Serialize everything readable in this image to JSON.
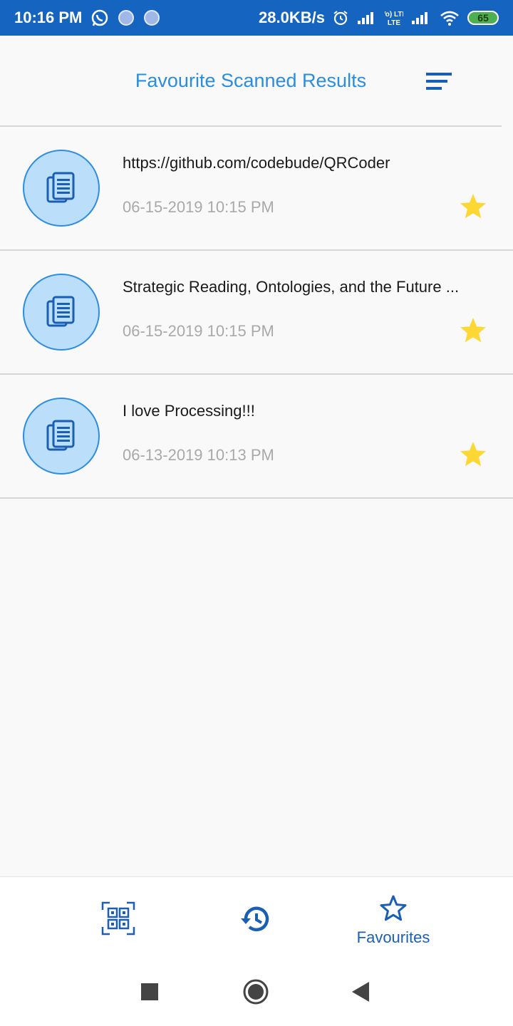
{
  "status_bar": {
    "time": "10:16 PM",
    "net_speed": "28.0KB/s",
    "battery": "65",
    "volte_label": "Vo) LTE",
    "icons": [
      "whatsapp-icon",
      "notification-dot-icon",
      "notification-dot-icon",
      "alarm-icon",
      "signal-icon",
      "volte-icon",
      "signal-icon",
      "wifi-icon",
      "battery-icon"
    ]
  },
  "toolbar": {
    "title": "Favourite Scanned Results",
    "sort_icon": "sort-icon"
  },
  "results": [
    {
      "title": "https://github.com/codebude/QRCoder",
      "date": "06-15-2019 10:15 PM",
      "icon": "document-icon",
      "favourite": true
    },
    {
      "title": "Strategic Reading, Ontologies, and the Future ...",
      "date": "06-15-2019 10:15 PM",
      "icon": "document-icon",
      "favourite": true
    },
    {
      "title": "I love Processing!!!",
      "date": "06-13-2019 10:13 PM",
      "icon": "document-icon",
      "favourite": true
    }
  ],
  "bottom_nav": {
    "scan_icon": "qr-scan-icon",
    "history_icon": "history-icon",
    "favourites_label": "Favourites",
    "favourites_icon": "star-outline-icon"
  },
  "system_nav": [
    "recents-square-icon",
    "home-circle-icon",
    "back-triangle-icon"
  ],
  "colors": {
    "status_bar": "#1565c0",
    "accent": "#2b8ddb",
    "nav_accent": "#1a5fb4",
    "avatar_fill": "#bbdefb",
    "star": "#fdd835"
  }
}
